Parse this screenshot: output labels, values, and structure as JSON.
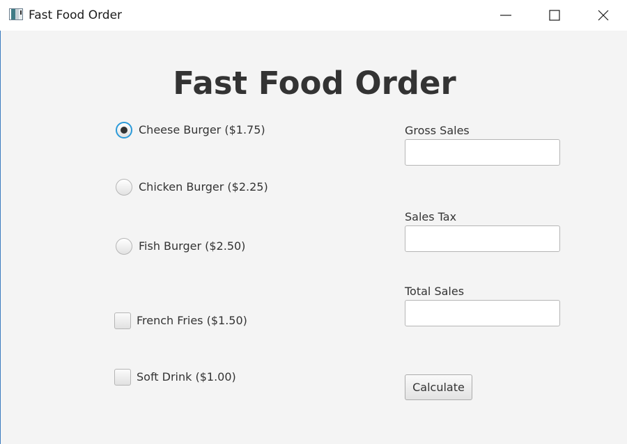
{
  "window": {
    "title": "Fast Food Order",
    "controls": {
      "minimize_icon": "minimize-icon",
      "maximize_icon": "maximize-icon",
      "close_icon": "close-icon"
    }
  },
  "heading": "Fast Food Order",
  "burgers": [
    {
      "label": "Cheese Burger ($1.75)",
      "selected": true
    },
    {
      "label": "Chicken Burger ($2.25)",
      "selected": false
    },
    {
      "label": "Fish Burger ($2.50)",
      "selected": false
    }
  ],
  "extras": [
    {
      "label": "French Fries ($1.50)",
      "checked": false
    },
    {
      "label": "Soft Drink ($1.00)",
      "checked": false
    }
  ],
  "fields": {
    "gross_sales": {
      "label": "Gross Sales",
      "value": ""
    },
    "sales_tax": {
      "label": "Sales Tax",
      "value": ""
    },
    "total_sales": {
      "label": "Total Sales",
      "value": ""
    }
  },
  "calculate_label": "Calculate",
  "colors": {
    "background": "#f4f4f4",
    "titlebar": "#ffffff",
    "focus_ring": "#2b9ad9",
    "text": "#333333"
  }
}
